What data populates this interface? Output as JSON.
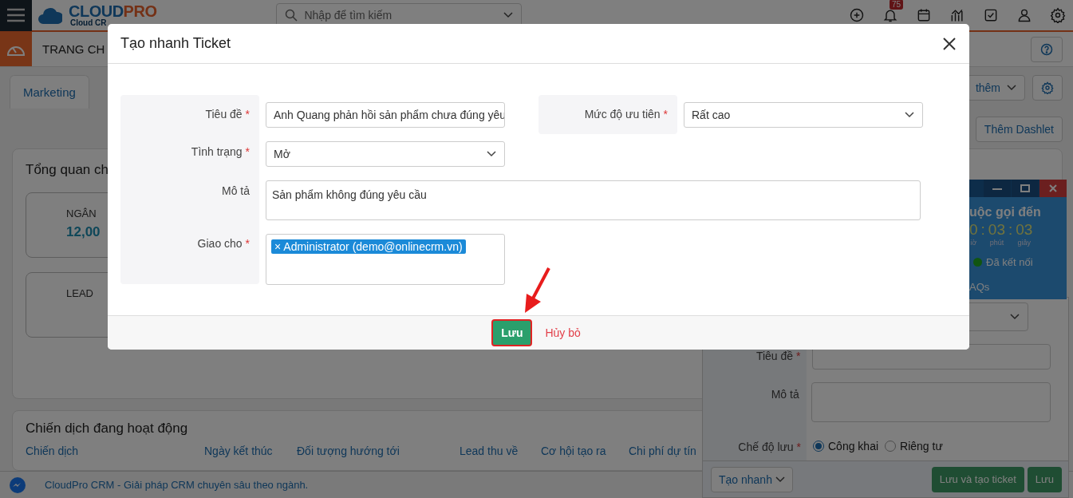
{
  "top_bar": {
    "logo": {
      "main": "CLOUD",
      "accent": "PRO",
      "tagline": "Cloud CR"
    },
    "search": {
      "placeholder": "Nhập để tìm kiếm"
    },
    "notification_count": "75"
  },
  "breadcrumb": {
    "title": "TRANG CH"
  },
  "tabs": [
    {
      "label": "Marketing",
      "selected": true
    }
  ],
  "more_button": "thêm",
  "add_dashlet": "Thêm Dashlet",
  "overview_card": {
    "title": "Tổng quan ch",
    "stats": [
      {
        "label": "NGÂN",
        "value": "12,00"
      },
      {
        "label": "LEAD"
      }
    ]
  },
  "campaign_card": {
    "title": "Chiến dịch đang hoạt động",
    "columns": [
      "Chiến dịch",
      "Ngày kết thúc",
      "Đối tượng hướng tới",
      "Lead thu về",
      "Cơ hội tạo ra",
      "Chi phí dự tín"
    ]
  },
  "footer": {
    "text": "CloudPro CRM - Giải pháp CRM chuyên sâu theo ngành."
  },
  "call_widget": {
    "title": "uộc gọi đến",
    "separator": ":",
    "timer": [
      {
        "value": "0",
        "unit": "iờ"
      },
      {
        "value": "03",
        "unit": "phút"
      },
      {
        "value": "03",
        "unit": "giây"
      }
    ],
    "status": "Đã kết nối",
    "link": "AQs"
  },
  "quick_panel": {
    "fields": [
      {
        "kind": "select"
      },
      {
        "kind": "text",
        "label": "Tiêu đề",
        "required_mark": "*"
      },
      {
        "kind": "textarea",
        "label": "Mô tả"
      },
      {
        "kind": "radio",
        "label": "Chế độ lưu",
        "required_mark": "*",
        "options": [
          {
            "label": "Công khai",
            "selected": true
          },
          {
            "label": "Riêng tư",
            "selected": false
          }
        ]
      }
    ],
    "menu_button": "Tạo nhanh",
    "buttons": [
      "Lưu và tạo ticket",
      "Lưu"
    ]
  },
  "modal": {
    "title": "Tạo nhanh Ticket",
    "rows": [
      [
        {
          "kind": "text",
          "label": "Tiêu đề",
          "required_mark": "*",
          "value": "Anh Quang phản hồi sản phẩm chưa đúng yêu"
        },
        {
          "kind": "select",
          "label": "Mức độ ưu tiên",
          "required_mark": "*",
          "value": "Rất cao"
        }
      ],
      [
        {
          "kind": "select",
          "label": "Tình trạng",
          "required_mark": "*",
          "value": "Mở"
        }
      ],
      [
        {
          "kind": "textarea",
          "label": "Mô tả",
          "value": "Sản phẩm không đúng yêu cầu"
        }
      ],
      [
        {
          "kind": "tags",
          "label": "Giao cho",
          "required_mark": "*",
          "tags": [
            {
              "remove": "×",
              "label": "Administrator (demo@onlinecrm.vn)"
            }
          ]
        }
      ]
    ],
    "save": "Lưu",
    "cancel": "Hủy bỏ"
  }
}
